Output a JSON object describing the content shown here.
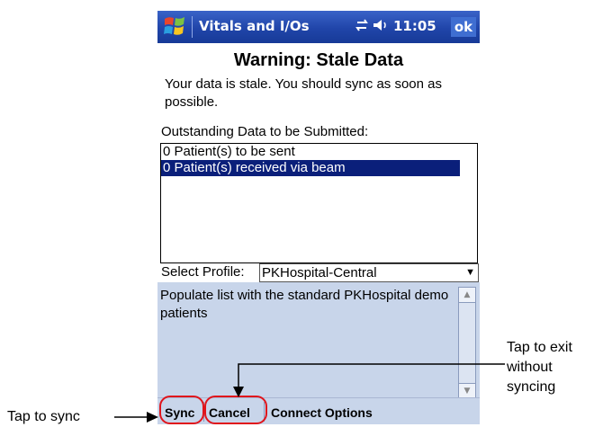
{
  "titlebar": {
    "app_title": "Vitals and I/Os",
    "status_icons": "⇄ ◀⁗",
    "clock": "11:05",
    "ok_label": "ok"
  },
  "warning": {
    "title": "Warning: Stale Data",
    "message": "Your data is stale. You should sync as soon as possible."
  },
  "outstanding_label": "Outstanding Data to be Submitted:",
  "list_items": [
    {
      "label": "0 Patient(s) to be sent"
    },
    {
      "label": "0 Patient(s) received via beam"
    }
  ],
  "profile": {
    "label": "Select Profile:",
    "selected": "PKHospital-Central"
  },
  "description": "Populate list with the standard PKHospital demo patients",
  "menubar": {
    "sync": "Sync",
    "cancel": "Cancel",
    "connect_options": "Connect Options"
  },
  "callouts": {
    "sync": "Tap to sync",
    "cancel": "Tap to exit without syncing"
  },
  "colors": {
    "titlebar": "#2045a9",
    "selection": "#0a1f7a",
    "panel": "#c8d5ea",
    "highlight": "#e0141b"
  }
}
